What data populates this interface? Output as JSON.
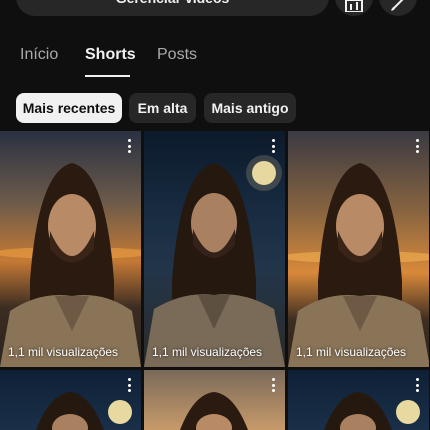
{
  "top_bar": {
    "manage_label": "Gerenciar vídeos",
    "stats_icon": "bar-chart-icon",
    "edit_icon": "pencil-icon"
  },
  "tabs": [
    {
      "label": "Início",
      "active": false
    },
    {
      "label": "Shorts",
      "active": true
    },
    {
      "label": "Posts",
      "active": false
    }
  ],
  "filters": [
    {
      "label": "Mais recentes",
      "selected": true
    },
    {
      "label": "Em alta",
      "selected": false
    },
    {
      "label": "Mais antigo",
      "selected": false
    }
  ],
  "shorts": [
    {
      "views": "1,1 mil visualizações",
      "scene": "sunset",
      "menu_icon": "more-vert-icon"
    },
    {
      "views": "1,1 mil visualizações",
      "scene": "moon",
      "menu_icon": "more-vert-icon"
    },
    {
      "views": "1,1 mil visualizações",
      "scene": "sunset",
      "menu_icon": "more-vert-icon"
    },
    {
      "views": "",
      "scene": "moon",
      "menu_icon": "more-vert-icon"
    },
    {
      "views": "",
      "scene": "sunset",
      "menu_icon": "more-vert-icon"
    },
    {
      "views": "",
      "scene": "moon",
      "menu_icon": "more-vert-icon"
    }
  ],
  "colors": {
    "background": "#0f0f0f",
    "chip_bg": "#272727",
    "chip_selected_bg": "#f1f1f1",
    "text_primary": "#f1f1f1",
    "text_secondary": "#aaaaaa"
  }
}
